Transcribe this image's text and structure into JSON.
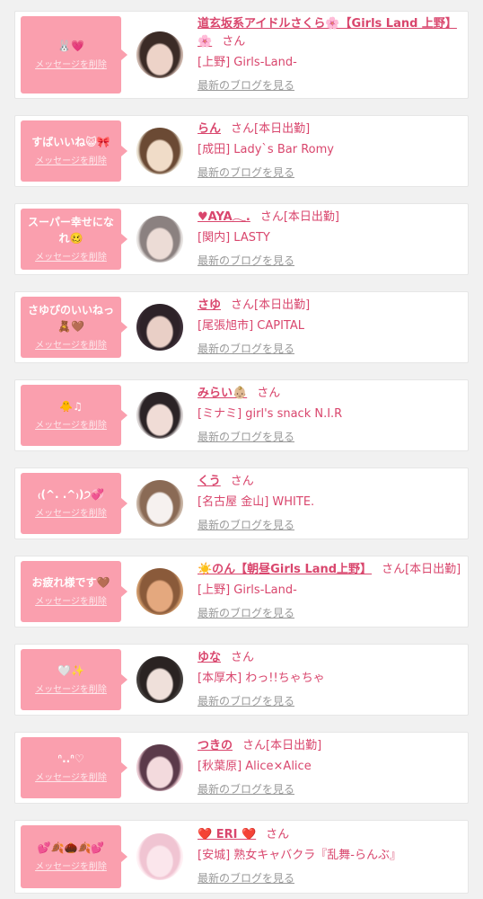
{
  "colors": {
    "bubble": "#fa9fae",
    "accent_text": "#d9466d",
    "muted_link": "#999999",
    "page_background": "#f1f1f1"
  },
  "cards": [
    {
      "message": "🐰💗",
      "delete_label": "メッセージを削除",
      "name": "道玄坂系アイドルさくら🌸【Girls Land 上野】🌸",
      "honorific": "さん",
      "shop": "[上野] Girls-Land-",
      "blog_label": "最新のブログを見る"
    },
    {
      "message": "すばいいね😺🎀",
      "delete_label": "メッセージを削除",
      "name": "らん",
      "honorific": "さん",
      "status": "[本日出勤]",
      "shop": "[成田] Lady`s Bar Romy",
      "blog_label": "最新のブログを見る"
    },
    {
      "message": "スーパー幸せになれ🥴",
      "delete_label": "メッセージを削除",
      "name": "♥AYA𓂃.",
      "honorific": "さん",
      "status": "[本日出勤]",
      "shop": "[関内] LASTY",
      "blog_label": "最新のブログを見る"
    },
    {
      "message": "さゆぴのいいねっ🧸🤎",
      "delete_label": "メッセージを削除",
      "name": "さゆ",
      "honorific": "さん",
      "status": "[本日出勤]",
      "shop": "[尾張旭市] CAPITAL",
      "blog_label": "最新のブログを見る"
    },
    {
      "message": "🐥♫",
      "delete_label": "メッセージを削除",
      "name": "みらい👶🏼",
      "honorific": "さん",
      "shop": "[ミナミ] girl's snack N.I.R",
      "blog_label": "最新のブログを見る"
    },
    {
      "message": "₍(^. .^₎)੭💞",
      "delete_label": "メッセージを削除",
      "name": "くう",
      "honorific": "さん",
      "shop": "[名古屋 金山] WHITE.",
      "blog_label": "最新のブログを見る"
    },
    {
      "message": "お疲れ様です🤎",
      "delete_label": "メッセージを削除",
      "name": "☀️のん【朝昼Girls Land上野】",
      "honorific": "さん",
      "status": "[本日出勤]",
      "shop": "[上野] Girls-Land-",
      "blog_label": "最新のブログを見る"
    },
    {
      "message": "🤍✨",
      "delete_label": "メッセージを削除",
      "name": "ゆな",
      "honorific": "さん",
      "shop": "[本厚木] わっ!!ちゃちゃ",
      "blog_label": "最新のブログを見る"
    },
    {
      "message": "ᐢ..ᐢ♡",
      "delete_label": "メッセージを削除",
      "name": "つきの",
      "honorific": "さん",
      "status": "[本日出勤]",
      "shop": "[秋葉原] Alice×Alice",
      "blog_label": "最新のブログを見る"
    },
    {
      "message": "💕🍂🌰🍂💕",
      "delete_label": "メッセージを削除",
      "name": "❤️ ERI ❤️",
      "honorific": "さん",
      "shop": "[安城] 熟女キャバクラ『乱舞-らんぶ』",
      "blog_label": "最新のブログを見る"
    }
  ]
}
